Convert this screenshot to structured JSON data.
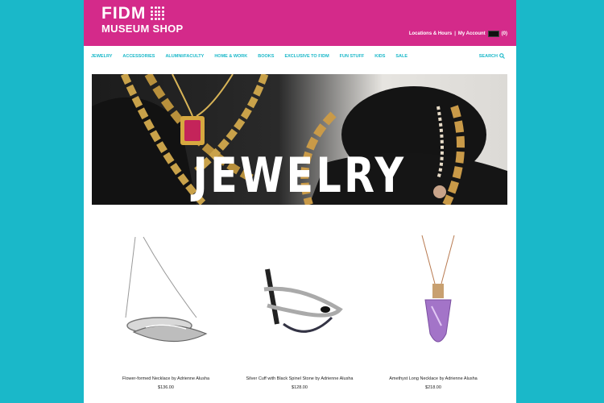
{
  "header": {
    "logo_title": "FIDM",
    "logo_subtitle": "MUSEUM SHOP",
    "locations_link": "Locations & Hours",
    "separator": "|",
    "account_link": "My Account",
    "cart_count": "(0)"
  },
  "nav": {
    "items": [
      "JEWELRY",
      "ACCESSORIES",
      "ALUMNI/FACULTY",
      "HOME & WORK",
      "BOOKS",
      "EXCLUSIVE TO FIDM",
      "FUN STUFF",
      "KIDS",
      "SALE"
    ],
    "search_label": "SEARCH"
  },
  "hero": {
    "title": "JEWELRY"
  },
  "products": [
    {
      "name": "Flower-formed Necklace by Adrienne Alusha",
      "price": "$136.00"
    },
    {
      "name": "Silver Cuff with Black Spinel Stone by Adrienne Alusha",
      "price": "$128.00"
    },
    {
      "name": "Amethyst Long Necklace by Adrienne Alusha",
      "price": "$218.00"
    }
  ],
  "colors": {
    "brand_pink": "#d42a8a",
    "accent_teal": "#1ab8c9"
  }
}
